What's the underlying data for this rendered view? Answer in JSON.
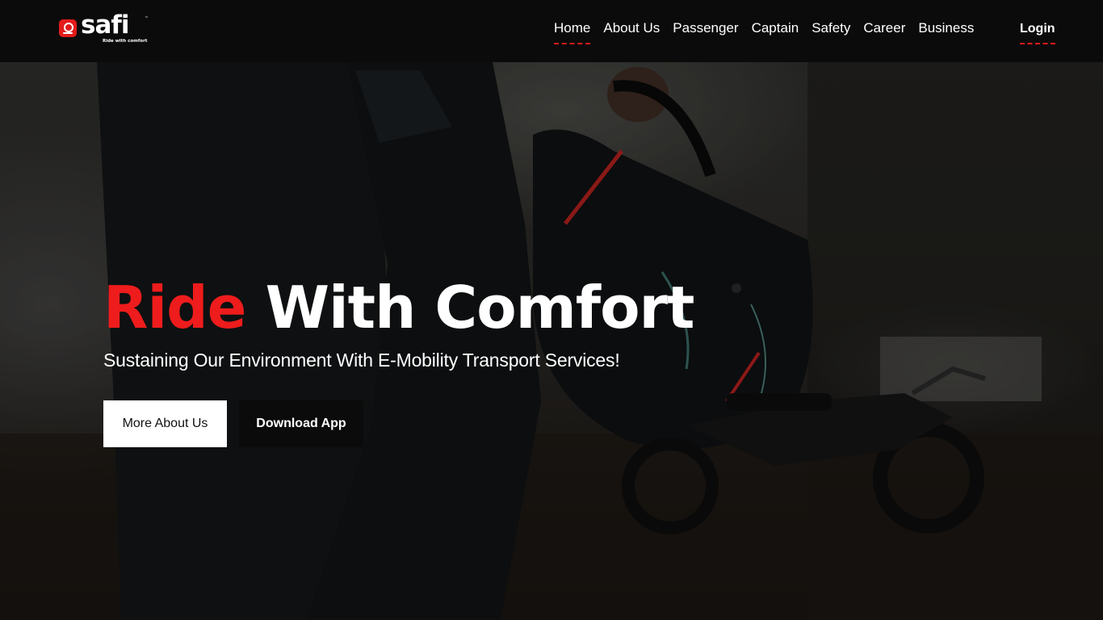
{
  "brand": {
    "name": "safi",
    "trademark": "™",
    "tagline": "Ride with comfort",
    "logo_color": "#e31b1b"
  },
  "nav": {
    "items": [
      {
        "label": "Home",
        "active": true
      },
      {
        "label": "About Us",
        "active": false
      },
      {
        "label": "Passenger",
        "active": false
      },
      {
        "label": "Captain",
        "active": false
      },
      {
        "label": "Safety",
        "active": false
      },
      {
        "label": "Career",
        "active": false
      },
      {
        "label": "Business",
        "active": false
      }
    ],
    "login_label": "Login"
  },
  "hero": {
    "title_accent": "Ride",
    "title_rest": "With Comfort",
    "subtitle": "Sustaining Our Environment With E-Mobility Transport Services!",
    "primary_button": "More About Us",
    "secondary_button": "Download App",
    "background_image": "person-holding-helmet-motorcycle-icon"
  },
  "colors": {
    "accent": "#ee1c1c",
    "navbar_bg": "#0b0b0b",
    "text": "#ffffff"
  }
}
